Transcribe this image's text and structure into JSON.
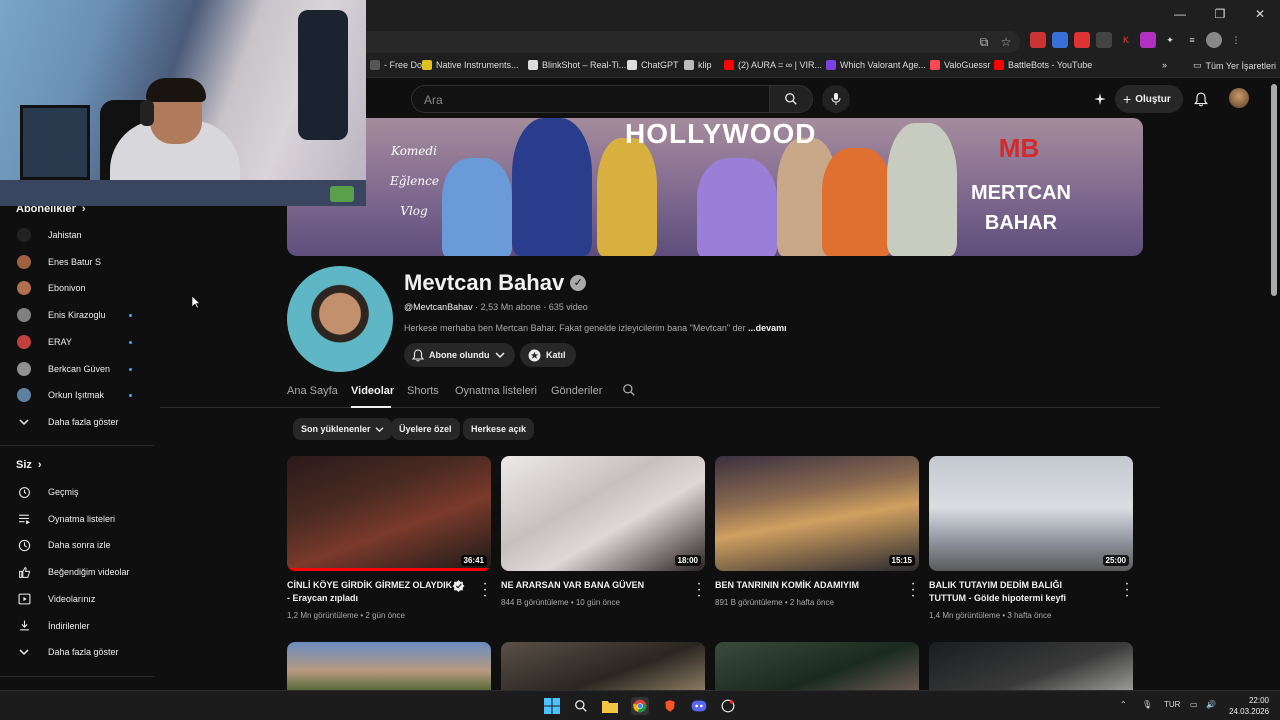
{
  "browser": {
    "bookmarks": [
      {
        "label": "- Free Do...",
        "color": "#555555"
      },
      {
        "label": "Native Instruments...",
        "color": "#e0c020"
      },
      {
        "label": "BlinkShot – Real-Ti...",
        "color": "#dddddd"
      },
      {
        "label": "ChatGPT",
        "color": "#dddddd"
      },
      {
        "label": "klip",
        "color": "#bbbbbb"
      },
      {
        "label": "(2) AURA = ∞ | VIR...",
        "color": "#ff0000"
      },
      {
        "label": "Which Valorant Age...",
        "color": "#7b3fe4"
      },
      {
        "label": "ValoGuessr",
        "color": "#ff4655"
      },
      {
        "label": "BattleBots - YouTube",
        "color": "#ff0000"
      }
    ],
    "all_bookmarks": "Tüm Yer İşaretleri"
  },
  "masthead": {
    "search_placeholder": "Ara",
    "create_label": "Oluştur"
  },
  "sidebar": {
    "subscriptions_title": "Abonelikler",
    "subscriptions": [
      {
        "label": "Jahistan",
        "color": "#222222",
        "dot": false
      },
      {
        "label": "Enes Batur S",
        "color": "#a06040",
        "dot": false
      },
      {
        "label": "Ebonivon",
        "color": "#b07050",
        "dot": false
      },
      {
        "label": "Enis Kirazoglu",
        "color": "#808080",
        "dot": true
      },
      {
        "label": "ERAY",
        "color": "#c04040",
        "dot": true
      },
      {
        "label": "Berkcan Güven",
        "color": "#909090",
        "dot": true
      },
      {
        "label": "Orkun Işıtmak",
        "color": "#6080a0",
        "dot": true
      }
    ],
    "show_more_1": "Daha fazla göster",
    "you_title": "Siz",
    "you_items": [
      {
        "label": "Geçmiş",
        "icon": "history-icon"
      },
      {
        "label": "Oynatma listeleri",
        "icon": "playlists-icon"
      },
      {
        "label": "Daha sonra izle",
        "icon": "watch-later-icon"
      },
      {
        "label": "Beğendiğim videolar",
        "icon": "like-icon"
      },
      {
        "label": "Videolarınız",
        "icon": "your-videos-icon"
      },
      {
        "label": "İndirilenler",
        "icon": "download-icon"
      }
    ],
    "show_more_2": "Daha fazla göster"
  },
  "banner": {
    "hollywood": "HOLLYWOOD",
    "labels": [
      "Komedi",
      "Eğlence",
      "Vlog"
    ],
    "brand_line1": "MERTCAN",
    "brand_line2": "BAHAR",
    "logo": "MB"
  },
  "channel": {
    "name": "Mevtcan Bahav",
    "handle": "@MevtcanBahav",
    "subscribers": "2,53 Mn abone",
    "video_count": "635 video",
    "description": "Herkese merhaba ben Mertcan Bahar. Fakat genelde izleyicilerim bana \"Mevtcan\" der",
    "more": "...devamı",
    "subscribed_label": "Abone olundu",
    "join_label": "Katıl"
  },
  "tabs": [
    {
      "label": "Ana Sayfa",
      "active": false
    },
    {
      "label": "Videolar",
      "active": true
    },
    {
      "label": "Shorts",
      "active": false
    },
    {
      "label": "Oynatma listeleri",
      "active": false
    },
    {
      "label": "Gönderiler",
      "active": false
    }
  ],
  "chips": [
    "Son yüklenenler",
    "Üyelere özel",
    "Herkese açık"
  ],
  "videos": [
    {
      "title": "CİNLİ KÖYE GİRDİK GİRMEZ OLAYDIK - Eraycan zıpladı",
      "views": "1,2 Mn görüntüleme",
      "age": "2 gün önce",
      "duration": "36:41"
    },
    {
      "title": "NE ARARSAN VAR BANA GÜVEN",
      "views": "844 B görüntüleme",
      "age": "10 gün önce",
      "duration": "18:00"
    },
    {
      "title": "BEN TANRININ KOMİK ADAMIYIM",
      "views": "891 B görüntüleme",
      "age": "2 hafta önce",
      "duration": "15:15"
    },
    {
      "title": "BALIK TUTAYIM DEDİM BALIĞI TUTTUM - Gölde hipotermi keyfi",
      "views": "1,4 Mn görüntüleme",
      "age": "3 hafta önce",
      "duration": "25:00"
    }
  ],
  "taskbar": {
    "lang": "TUR",
    "time": "22:00",
    "date": "24.03.2026"
  },
  "colors": {
    "background": "#0f0f0f",
    "accent_blue": "#3ea6ff",
    "text_secondary": "#aaaaaa"
  }
}
